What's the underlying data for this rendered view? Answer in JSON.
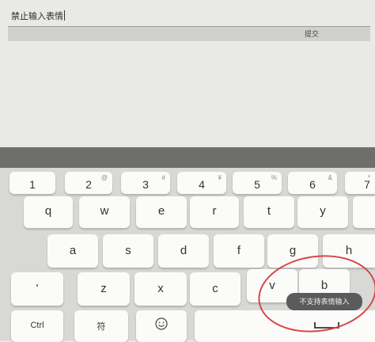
{
  "input": {
    "value": "禁止输入表情"
  },
  "submit": {
    "label": "提交"
  },
  "keyboard": {
    "number_row": [
      {
        "label": "1",
        "sub": ""
      },
      {
        "label": "2",
        "sub": "@"
      },
      {
        "label": "3",
        "sub": "#"
      },
      {
        "label": "4",
        "sub": "¥"
      },
      {
        "label": "5",
        "sub": "%"
      },
      {
        "label": "6",
        "sub": "&"
      },
      {
        "label": "7",
        "sub": "*"
      }
    ],
    "row_q": [
      "q",
      "w",
      "e",
      "r",
      "t",
      "y"
    ],
    "row_a": [
      "a",
      "s",
      "d",
      "f",
      "g",
      "h"
    ],
    "row_z": [
      "'",
      "z",
      "x",
      "c",
      "v",
      "b"
    ],
    "bottom": {
      "ctrl": "Ctrl",
      "symbols": "符"
    }
  },
  "toast": {
    "text": "不支持表情输入"
  },
  "colors": {
    "annotation_circle": "#d6474a",
    "toast_bg": "#5b5b5b",
    "keyboard_bar": "#6e6e6c"
  }
}
